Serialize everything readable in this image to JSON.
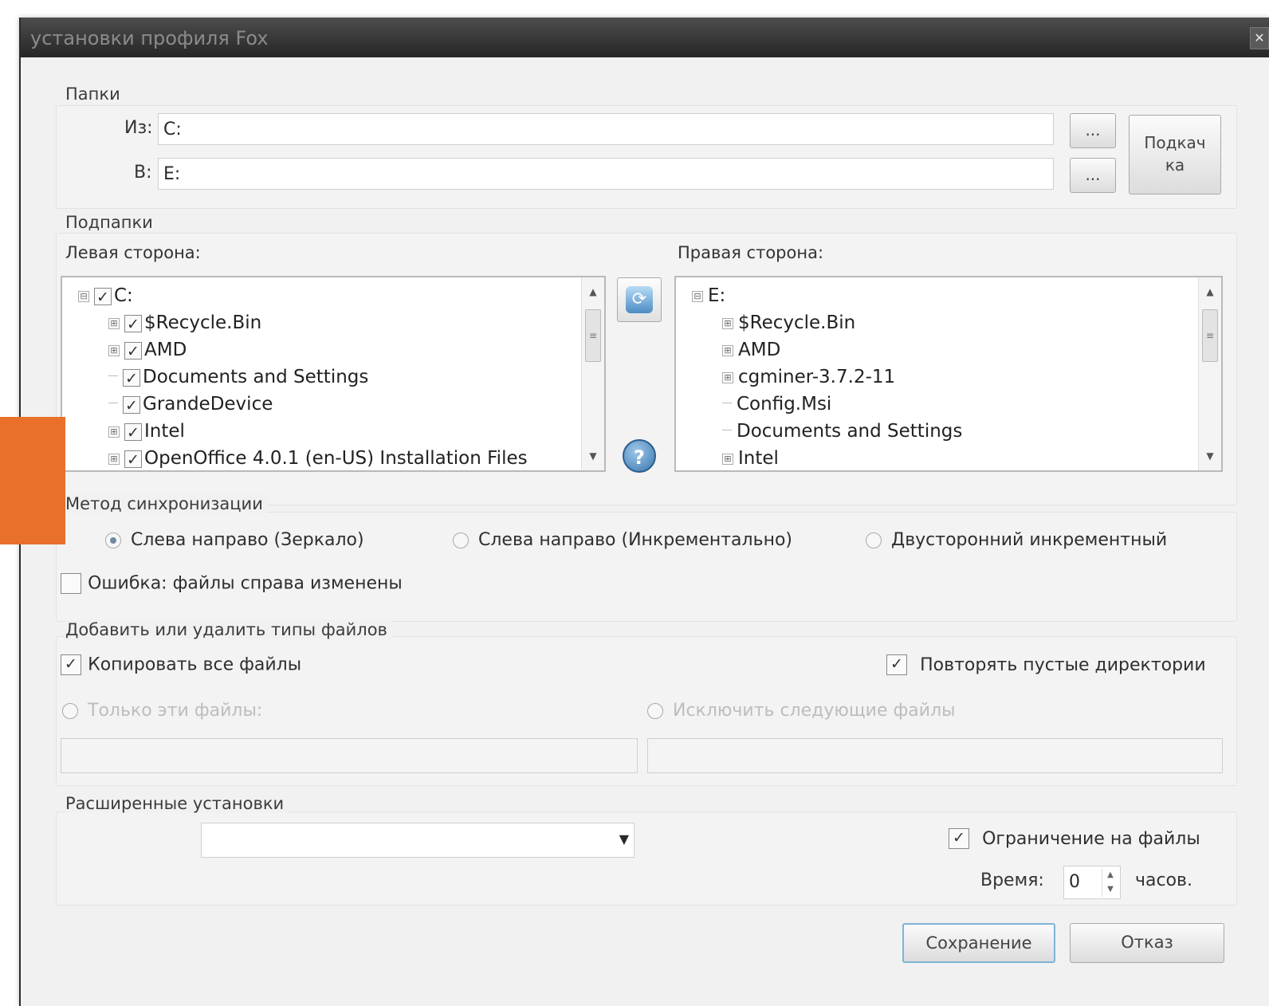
{
  "window": {
    "title": "установки профиля Fox",
    "close_glyph": "✕"
  },
  "folders": {
    "group_label": "Папки",
    "from_label": "Из:",
    "from_value": "C:",
    "to_label": "В:",
    "to_value": "E:",
    "browse_label": "...",
    "pump_label_line1": "Подкач",
    "pump_label_line2": "ка"
  },
  "subfolders": {
    "group_label": "Подпапки",
    "left_label": "Левая сторона:",
    "right_label": "Правая сторона:",
    "left_items": [
      {
        "label": "C:",
        "expander": "⊟",
        "checked": true,
        "level": 0
      },
      {
        "label": "$Recycle.Bin",
        "expander": "⊞",
        "checked": true,
        "level": 1
      },
      {
        "label": "AMD",
        "expander": "⊞",
        "checked": true,
        "level": 1
      },
      {
        "label": "Documents and Settings",
        "expander": "",
        "checked": true,
        "level": 1
      },
      {
        "label": "GrandeDevice",
        "expander": "",
        "checked": true,
        "level": 1
      },
      {
        "label": "Intel",
        "expander": "⊞",
        "checked": true,
        "level": 1
      },
      {
        "label": "OpenOffice 4.0.1 (en-US) Installation Files",
        "expander": "⊞",
        "checked": true,
        "level": 1
      }
    ],
    "right_items": [
      {
        "label": "E:",
        "expander": "⊟",
        "level": 0
      },
      {
        "label": "$Recycle.Bin",
        "expander": "⊞",
        "level": 1
      },
      {
        "label": "AMD",
        "expander": "⊞",
        "level": 1
      },
      {
        "label": "cgminer-3.7.2-11",
        "expander": "⊞",
        "level": 1
      },
      {
        "label": "Config.Msi",
        "expander": "",
        "level": 1
      },
      {
        "label": "Documents and Settings",
        "expander": "",
        "level": 1
      },
      {
        "label": "Intel",
        "expander": "⊞",
        "level": 1
      }
    ],
    "check_glyph": "✓",
    "sync_glyph": "⟳",
    "help_glyph": "?"
  },
  "sync_method": {
    "group_label": "Метод синхронизации",
    "options": [
      {
        "label": "Слева направо (Зеркало)",
        "selected": true
      },
      {
        "label": "Слева направо (Инкрементально)",
        "selected": false
      },
      {
        "label": "Двусторонний инкрементный",
        "selected": false
      }
    ],
    "error_checkbox_label": "Ошибка: файлы справа изменены",
    "error_checked": false
  },
  "file_types": {
    "group_label": "Добавить или удалить типы файлов",
    "copy_all_label": "Копировать все файлы",
    "copy_all_checked": true,
    "repeat_empty_label": "Повторять пустые директории",
    "repeat_empty_checked": true,
    "only_these_label": "Только эти файлы:",
    "exclude_label": "Исключить следующие файлы",
    "only_these_value": "",
    "exclude_value": ""
  },
  "advanced": {
    "group_label": "Расширенные установки",
    "combo_value": "",
    "combo_arrow": "▼",
    "limit_label": "Ограничение на файлы",
    "limit_checked": true,
    "time_label": "Время:",
    "time_value": "0",
    "time_unit": "часов."
  },
  "buttons": {
    "save": "Сохранение",
    "cancel": "Отказ"
  }
}
